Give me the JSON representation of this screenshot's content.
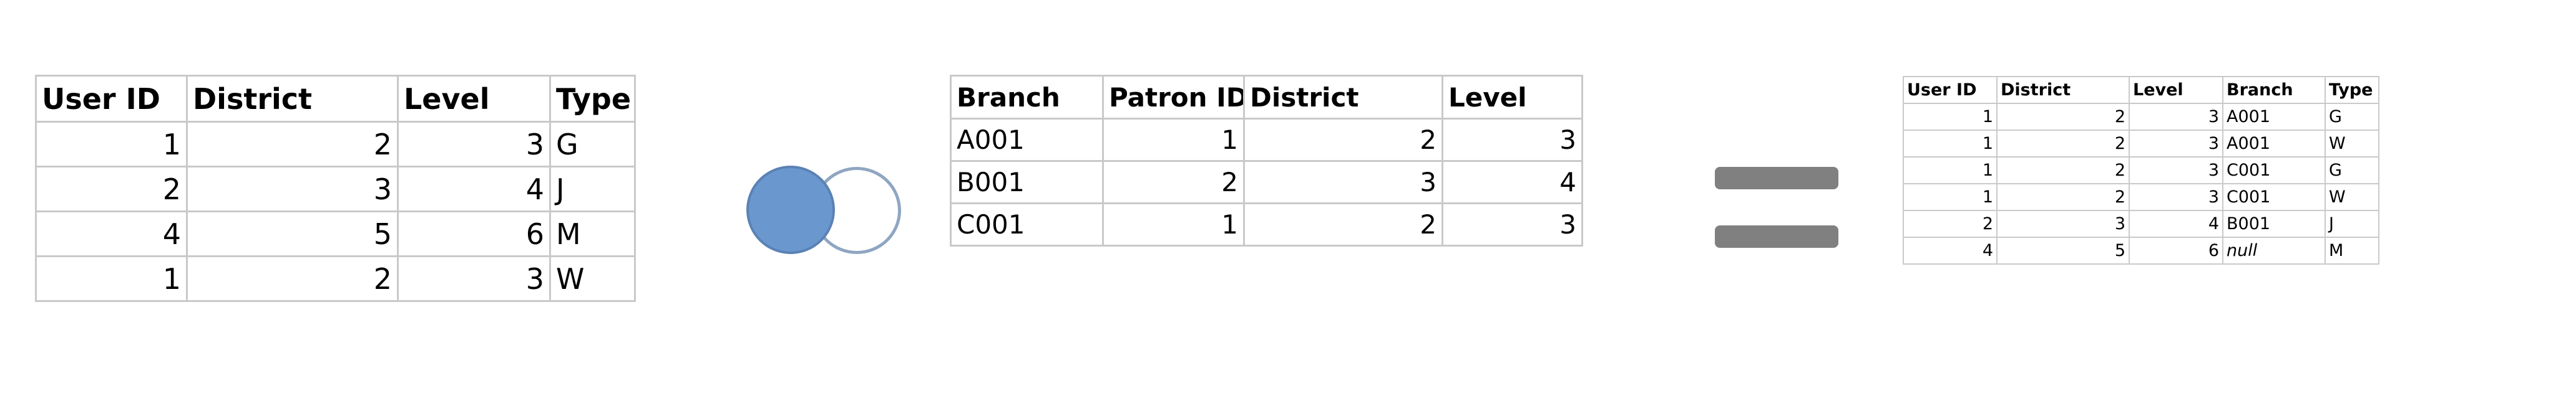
{
  "left_table": {
    "headers": [
      "User ID",
      "District",
      "Level",
      "Type"
    ],
    "rows": [
      [
        "1",
        "2",
        "3",
        "G"
      ],
      [
        "2",
        "3",
        "4",
        "J"
      ],
      [
        "4",
        "5",
        "6",
        "M"
      ],
      [
        "1",
        "2",
        "3",
        "W"
      ]
    ]
  },
  "middle_table": {
    "headers": [
      "Branch",
      "Patron ID",
      "District",
      "Level"
    ],
    "rows": [
      [
        "A001",
        "1",
        "2",
        "3"
      ],
      [
        "B001",
        "2",
        "3",
        "4"
      ],
      [
        "C001",
        "1",
        "2",
        "3"
      ]
    ]
  },
  "join_symbol": {
    "type": "left-outer-join-icon",
    "left_fill": "#6b97cf",
    "right_outline": "#8fa6c2"
  },
  "equals_symbol": {
    "color": "#808080"
  },
  "result_table": {
    "headers": [
      "User ID",
      "District",
      "Level",
      "Branch",
      "Type"
    ],
    "rows": [
      [
        "1",
        "2",
        "3",
        "A001",
        "G"
      ],
      [
        "1",
        "2",
        "3",
        "A001",
        "W"
      ],
      [
        "1",
        "2",
        "3",
        "C001",
        "G"
      ],
      [
        "1",
        "2",
        "3",
        "C001",
        "W"
      ],
      [
        "2",
        "3",
        "4",
        "B001",
        "J"
      ],
      [
        "4",
        "5",
        "6",
        "null",
        "M"
      ]
    ]
  }
}
